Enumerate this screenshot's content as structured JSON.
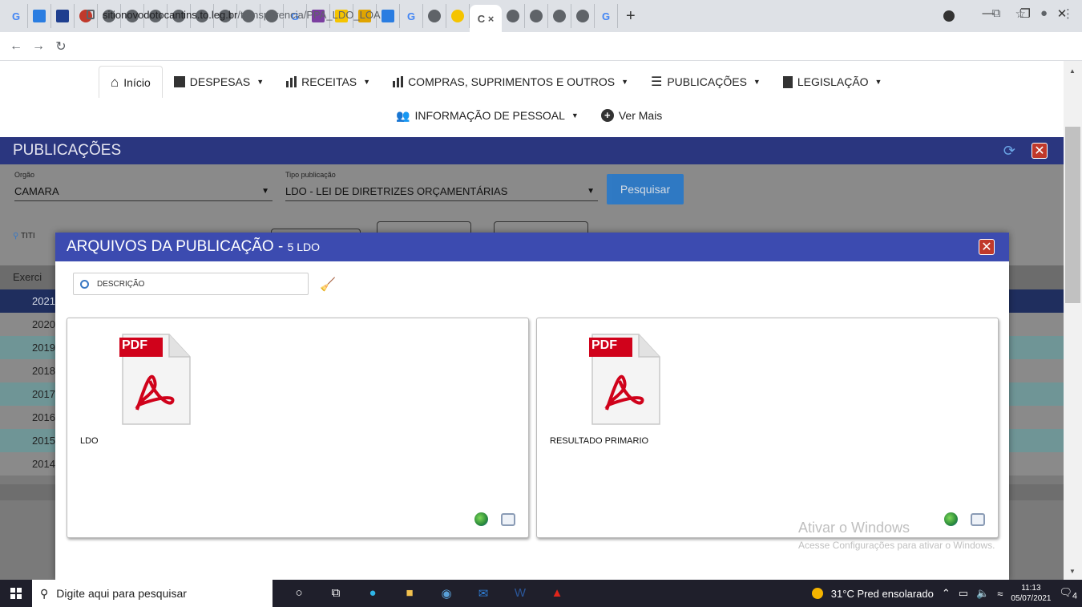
{
  "browser": {
    "url_host": "sitionovodotocantins.to.leg.br",
    "url_path": "/transparencia/PPA_LDO_LOA",
    "active_tab_label": "C ×",
    "new_tab": "+"
  },
  "nav": {
    "home": "Início",
    "despesas": "DESPESAS",
    "receitas": "RECEITAS",
    "compras": "COMPRAS, SUPRIMENTOS E OUTROS",
    "publicacoes": "PUBLICAÇÕES",
    "legislacao": "LEGISLAÇÃO",
    "pessoal": "INFORMAÇÃO DE PESSOAL",
    "ver_mais": "Ver Mais"
  },
  "page": {
    "title": "PUBLICAÇÕES",
    "orgao_label": "Orgão",
    "orgao_value": "CAMARA",
    "tipo_label": "Tipo publicação",
    "tipo_value": "LDO - LEI DE DIRETRIZES ORÇAMENTÁRIAS",
    "pesquisar": "Pesquisar",
    "search_partial": "TITI",
    "years_header": "Exerci",
    "years": [
      "2021",
      "2020",
      "2019",
      "2018",
      "2017",
      "2016",
      "2015",
      "2014"
    ]
  },
  "modal": {
    "title": "ARQUIVOS DA PUBLICAÇÃO - ",
    "subtitle": "5 LDO",
    "search_placeholder": "DESCRIÇÃO",
    "files": [
      {
        "name": "LDO",
        "badge": "PDF"
      },
      {
        "name": "RESULTADO PRIMARIO",
        "badge": "PDF"
      }
    ]
  },
  "watermark": {
    "line1": "Ativar o Windows",
    "line2": "Acesse Configurações para ativar o Windows."
  },
  "taskbar": {
    "search": "Digite aqui para pesquisar",
    "weather": "31°C  Pred ensolarado",
    "time": "11:13",
    "date": "05/07/2021",
    "notif_count": "4"
  },
  "colors": {
    "header_blue": "#2a367f",
    "modal_blue": "#3c4bb0",
    "button_blue": "#1976d2",
    "pdf_red": "#d0021b"
  }
}
